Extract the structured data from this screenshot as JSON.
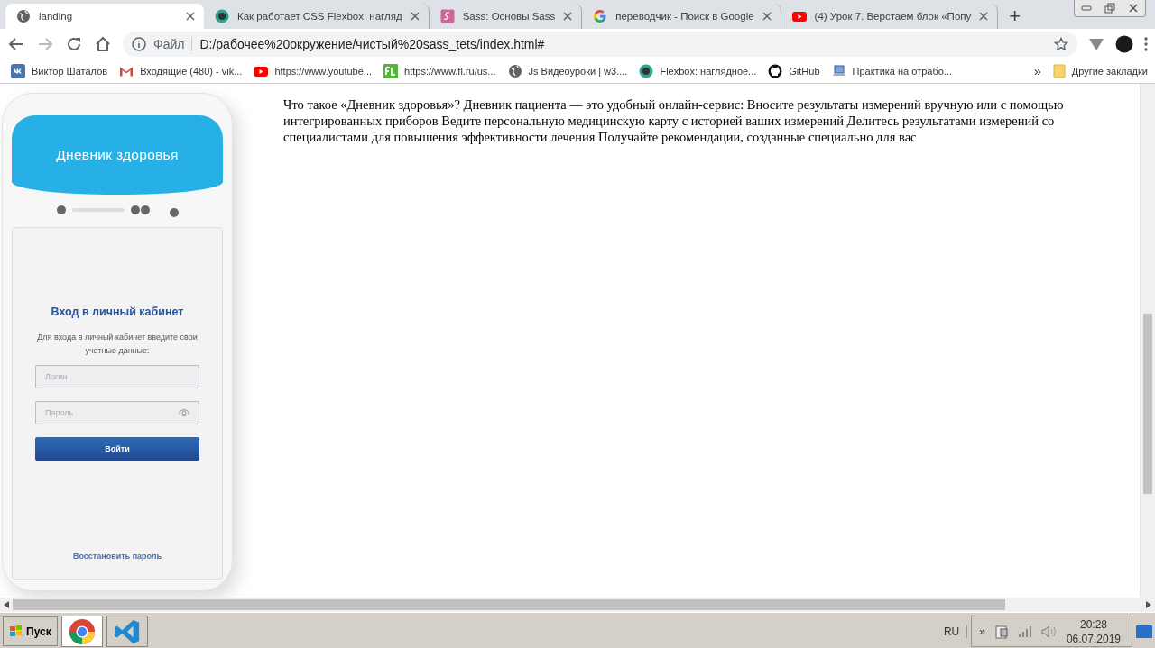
{
  "tabs": [
    {
      "title": "landing",
      "selected": true
    },
    {
      "title": "Как работает CSS Flexbox: нагляд",
      "selected": false
    },
    {
      "title": "Sass: Основы Sass",
      "selected": false
    },
    {
      "title": "переводчик - Поиск в Google",
      "selected": false
    },
    {
      "title": "(4) Урок 7. Верстаем блок «Попу",
      "selected": false
    }
  ],
  "new_tab": "+",
  "address": {
    "scheme_label": "Файл",
    "url": "D:/рабочее%20окружение/чистый%20sass_tets/index.html#"
  },
  "bookmarks": [
    "Виктор Шаталов",
    "Входящие (480) - vik...",
    "https://www.youtube...",
    "https://www.fl.ru/us...",
    "Js Видеоуроки | w3....",
    "Flexbox: наглядное...",
    "GitHub",
    "Практика на отрабо..."
  ],
  "bookmarks_more": "»",
  "other_bookmarks": "Другие закладки",
  "phone": {
    "app_title": "Дневник здоровья",
    "heading": "Вход в личный кабинет",
    "hint": "Для входа в личный кабинет введите свои учетные данные:",
    "login_placeholder": "Логин",
    "password_placeholder": "Пароль",
    "submit": "Войти",
    "restore": "Восстановить пароль"
  },
  "paragraph": "Что такое «Дневник здоровья»? Дневник пациента — это удобный онлайн-сервис: Вносите результаты измерений вручную или с помощью интегрированных приборов Ведите персональную медицинскую карту с историей ваших измерений Делитесь результатами измерений со специалистами для повышения эффективности лечения Получайте рекомендации, созданные специально для вас",
  "taskbar": {
    "start": "Пуск",
    "apps": [
      {
        "selected": true
      },
      {
        "selected": false
      }
    ],
    "language": "RU",
    "tray_chevron": "»",
    "time": "20:28",
    "date": "06.07.2019"
  }
}
